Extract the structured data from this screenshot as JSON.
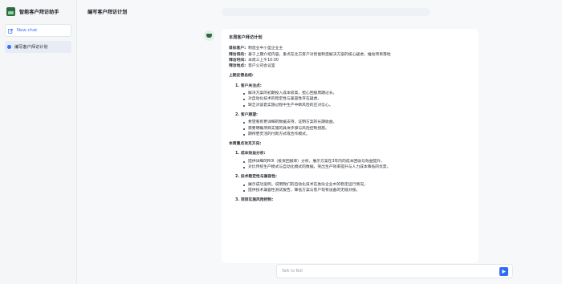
{
  "app": {
    "title": "智能客户拜访助手"
  },
  "sidebar": {
    "new_chat_label": "New chat",
    "sessions": [
      {
        "label": "编写客户拜访计划"
      }
    ]
  },
  "header": {
    "title": "编写客户拜访计划"
  },
  "message": {
    "title": "本周客户拜访计划",
    "info": [
      {
        "key": "目标客户:",
        "value": "制造业中小型企业主"
      },
      {
        "key": "拜访目的:",
        "value": "基于上期介绍内容，重点在北方客户对智能制造解决方案的核心疑虑，推动项目落地"
      },
      {
        "key": "拜访时间:",
        "value": "本周三上午10:00"
      },
      {
        "key": "拜访地点:",
        "value": "客户公司会议室"
      }
    ],
    "review_heading": "上期反馈总结:",
    "review": [
      {
        "heading": "1. 客户关注点:",
        "bullets": [
          "解决方案的初期投入成本较高，担心回报周期过长。",
          "对自动化技术的稳定性与兼容性存在疑虑。",
          "缺乏对该套实施过程中生产中断风险的应对信心。"
        ]
      },
      {
        "heading": "2. 客户期望:",
        "bullets": [
          "希望看到更详细的数据支持，证明方案的长期收益。",
          "需要明确项目实施的具体步骤与风险控制措施。",
          "期待更灵活的付款方式或合作模式。"
        ]
      }
    ],
    "focus_heading": "本周重点攻克方向:",
    "focus": [
      {
        "heading": "1. 成本效益分析:",
        "bullets": [
          "提供详细的ROI（投资回报率）分析，展示方案在3年内的成本回收与效益提升。",
          "对比传统生产模式与自动化模式的数据，突出生产效率提升与人力成本降低的优势。"
        ]
      },
      {
        "heading": "2. 技术稳定性与兼容性:",
        "bullets": [
          "展示成功案例，说明我们的自动化技术在类似企业中的稳定运行情况。",
          "提供技术兼容性测试报告，降低方案与客户现有设备的无缝对接。"
        ]
      },
      {
        "heading": "3. 项目实施风险控制:",
        "bullets": []
      }
    ]
  },
  "composer": {
    "placeholder": "Talk to Bot"
  },
  "icons": {
    "brand": "app-logo-icon",
    "new_chat": "edit-icon",
    "session": "chat-bubble-icon",
    "bot": "bot-avatar-icon",
    "send": "send-icon"
  },
  "colors": {
    "accent": "#3370ff",
    "send_button": "#2f6cf6",
    "brand": "#2e6b45"
  }
}
